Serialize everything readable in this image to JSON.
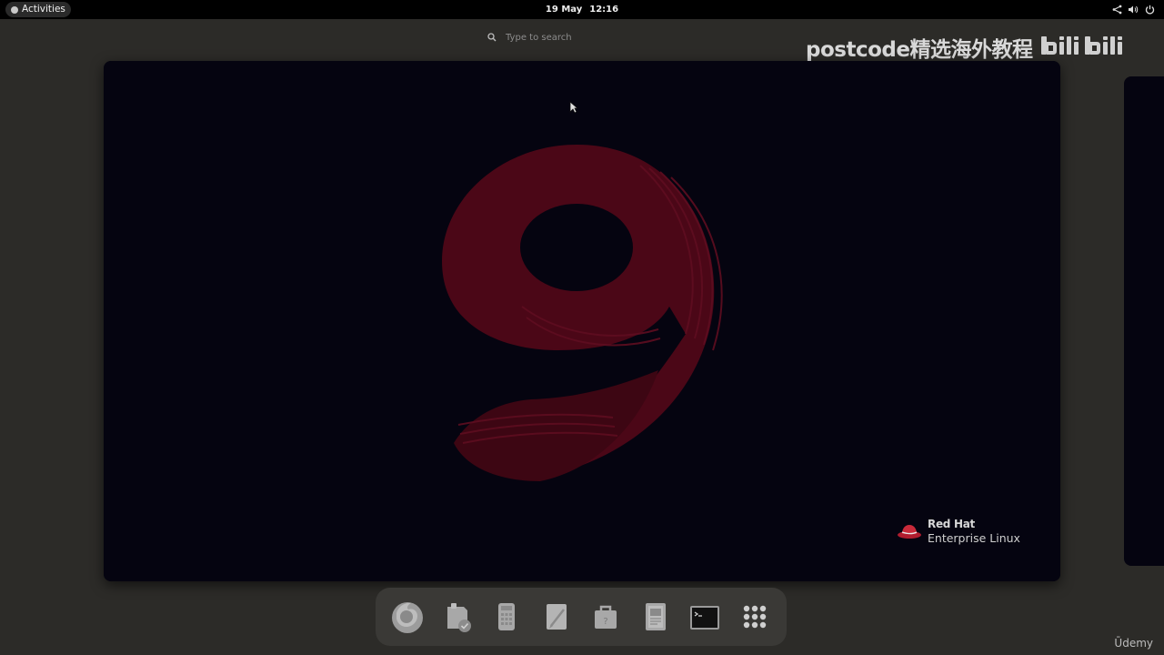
{
  "topbar": {
    "activities_label": "Activities",
    "date": "19 May",
    "time": "12:16",
    "tray_icons": [
      "network-icon",
      "volume-icon",
      "power-icon"
    ]
  },
  "search": {
    "placeholder": "Type to search"
  },
  "watermark": {
    "text": "postcode精选海外教程",
    "logo": "bilibili"
  },
  "workspace": {
    "wallpaper": "rhel-9-logo",
    "brand_line1": "Red Hat",
    "brand_line2": "Enterprise Linux"
  },
  "dock": {
    "items": [
      {
        "name": "firefox",
        "icon": "firefox-icon"
      },
      {
        "name": "software",
        "icon": "software-icon"
      },
      {
        "name": "calculator",
        "icon": "calculator-icon"
      },
      {
        "name": "text-editor",
        "icon": "text-editor-icon"
      },
      {
        "name": "help",
        "icon": "help-icon"
      },
      {
        "name": "document-viewer",
        "icon": "document-viewer-icon"
      },
      {
        "name": "terminal",
        "icon": "terminal-icon"
      },
      {
        "name": "show-applications",
        "icon": "app-grid-icon"
      }
    ]
  },
  "footer": {
    "udemy": "Ūdemy"
  },
  "colors": {
    "topbar_bg": "#000000",
    "overview_bg": "#2c2b28",
    "wallpaper_bg": "#050410",
    "logo_red": "#5a0a1c",
    "dock_bg": "#3a3936"
  }
}
